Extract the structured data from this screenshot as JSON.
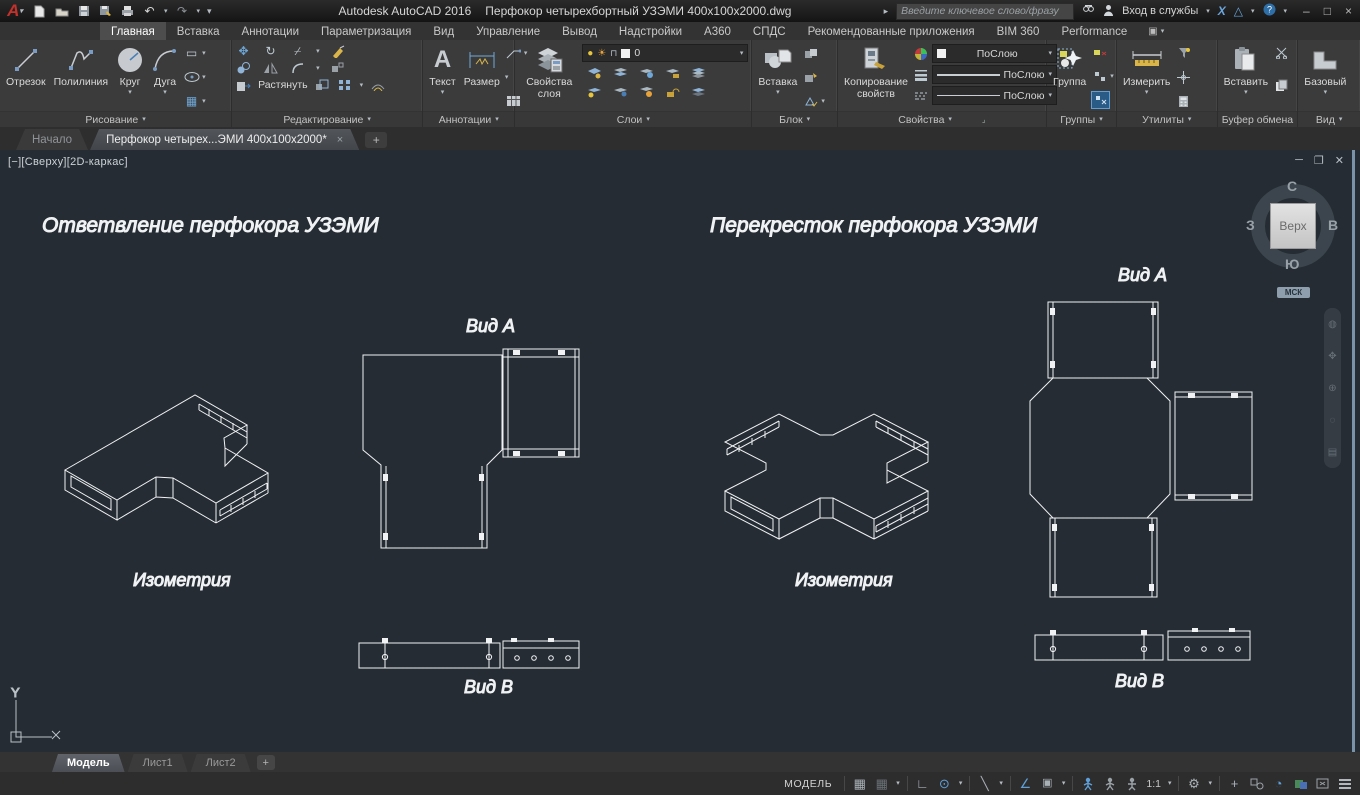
{
  "title_bar": {
    "app_title": "Autodesk AutoCAD 2016",
    "doc_title": "Перфокор четырехбортный УЗЭМИ 400x100x2000.dwg",
    "search_placeholder": "Введите ключевое слово/фразу",
    "sign_in_label": "Вход в службы",
    "window_buttons": {
      "minimize": "–",
      "restore": "□",
      "close": "×"
    }
  },
  "ribbon_tabs": [
    "Главная",
    "Вставка",
    "Аннотации",
    "Параметризация",
    "Вид",
    "Управление",
    "Вывод",
    "Надстройки",
    "A360",
    "СПДС",
    "Рекомендованные приложения",
    "BIM 360",
    "Performance"
  ],
  "ribbon": {
    "draw": {
      "label": "Рисование",
      "line": "Отрезок",
      "polyline": "Полилиния",
      "circle": "Круг",
      "arc": "Дуга"
    },
    "modify": {
      "label": "Редактирование",
      "stretch": "Растянуть"
    },
    "annotation": {
      "label": "Аннотации",
      "text": "Текст",
      "dimension": "Размер"
    },
    "layers": {
      "label": "Слои",
      "properties_line1": "Свойства",
      "properties_line2": "слоя",
      "current": "0"
    },
    "block": {
      "label": "Блок",
      "insert": "Вставка"
    },
    "properties": {
      "label": "Свойства",
      "match_line1": "Копирование",
      "match_line2": "свойств",
      "bylayer": "ПоСлою"
    },
    "groups": {
      "label": "Группы",
      "group": "Группа"
    },
    "utilities": {
      "label": "Утилиты",
      "measure": "Измерить"
    },
    "clipboard": {
      "label": "Буфер обмена",
      "paste": "Вставить"
    },
    "view": {
      "label": "Вид",
      "base": "Базовый"
    }
  },
  "file_tabs": {
    "start": "Начало",
    "document": "Перфокор четырех...ЭМИ 400x100x2000*",
    "close": "×",
    "add": "+"
  },
  "viewport": {
    "controls": "[−][Сверху][2D-каркас]"
  },
  "viewcube": {
    "north": "С",
    "south": "Ю",
    "east": "В",
    "west": "З",
    "top": "Верх",
    "ucs": "МСК"
  },
  "drawings": {
    "left": {
      "title": "Ответвление перфокора УЗЭМИ",
      "iso": "Изометрия",
      "view_a": "Вид А",
      "view_b": "Вид В"
    },
    "right": {
      "title": "Перекресток перфокора УЗЭМИ",
      "iso": "Изометрия",
      "view_a": "Вид А",
      "view_b": "Вид В"
    }
  },
  "ucs_icon": {
    "x": "X",
    "y": "Y"
  },
  "layout_tabs": {
    "model": "Модель",
    "layout1": "Лист1",
    "layout2": "Лист2",
    "add": "+"
  },
  "status_bar": {
    "model_label": "МОДЕЛЬ",
    "scale": "1:1"
  },
  "colors": {
    "accent_blue": "#5f9fd8",
    "canvas_bg": "#252c33",
    "line_white": "#f0f2f4",
    "logo_red": "#c2312b"
  }
}
